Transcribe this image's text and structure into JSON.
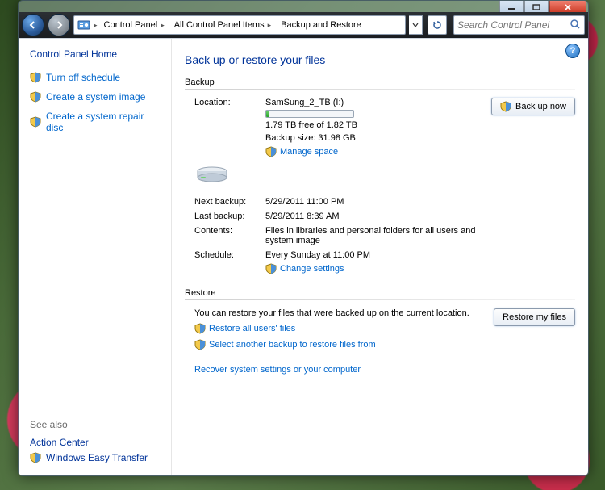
{
  "window": {
    "min_tip": "Minimize",
    "max_tip": "Maximize",
    "close_tip": "Close"
  },
  "nav": {
    "crumb1": "Control Panel",
    "crumb2": "All Control Panel Items",
    "crumb3": "Backup and Restore",
    "search_placeholder": "Search Control Panel"
  },
  "sidebar": {
    "home": "Control Panel Home",
    "items": [
      {
        "label": "Turn off schedule"
      },
      {
        "label": "Create a system image"
      },
      {
        "label": "Create a system repair disc"
      }
    ],
    "seealso": "See also",
    "seealso_items": [
      {
        "label": "Action Center"
      },
      {
        "label": "Windows Easy Transfer"
      }
    ]
  },
  "page": {
    "title": "Back up or restore your files",
    "backup_section": "Backup",
    "restore_section": "Restore",
    "location_label": "Location:",
    "location_value": "SamSung_2_TB (I:)",
    "free_space": "1.79 TB free of 1.82 TB",
    "backup_size": "Backup size: 31.98 GB",
    "manage_space": "Manage space",
    "next_backup_label": "Next backup:",
    "next_backup_value": "5/29/2011 11:00 PM",
    "last_backup_label": "Last backup:",
    "last_backup_value": "5/29/2011 8:39 AM",
    "contents_label": "Contents:",
    "contents_value": "Files in libraries and personal folders for all users and system image",
    "schedule_label": "Schedule:",
    "schedule_value": "Every Sunday at 11:00 PM",
    "change_settings": "Change settings",
    "backup_now_btn": "Back up now",
    "restore_text": "You can restore your files that were backed up on the current location.",
    "restore_my_files_btn": "Restore my files",
    "restore_all_users": "Restore all users' files",
    "select_another": "Select another backup to restore files from",
    "recover_system": "Recover system settings or your computer"
  }
}
